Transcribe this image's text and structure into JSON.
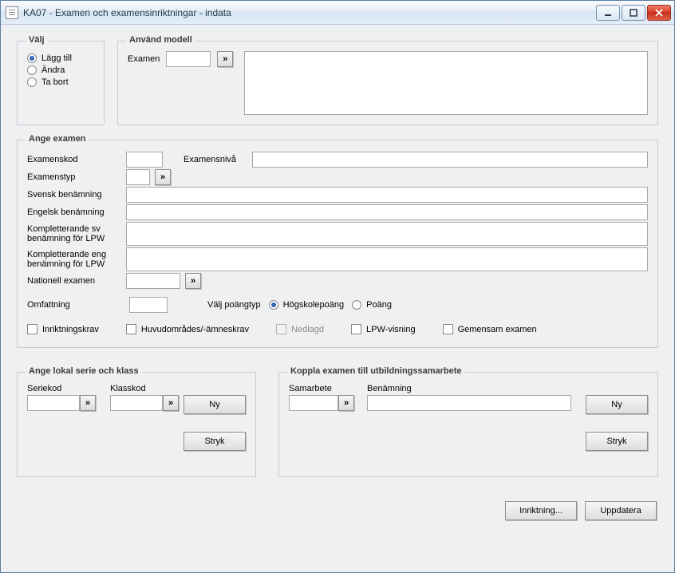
{
  "window": {
    "title": "KA07 - Examen och examensinriktningar - indata"
  },
  "valj": {
    "legend": "Välj",
    "opt_add": "Lägg till",
    "opt_edit": "Ändra",
    "opt_delete": "Ta bort",
    "selected": "add"
  },
  "modell": {
    "legend": "Använd modell",
    "examen_label": "Examen",
    "examen_value": ""
  },
  "ange": {
    "legend": "Ange examen",
    "examenskod_label": "Examenskod",
    "examenskod_value": "",
    "examensniva_label": "Examensnivå",
    "examensniva_value": "",
    "examenstyp_label": "Examenstyp",
    "examenstyp_value": "",
    "svensk_label": "Svensk benämning",
    "svensk_value": "",
    "engelsk_label": "Engelsk benämning",
    "engelsk_value": "",
    "kompl_sv_label_l1": "Kompletterande sv",
    "kompl_sv_label_l2": "benämning för LPW",
    "kompl_sv_value": "",
    "kompl_en_label_l1": "Kompletterande eng",
    "kompl_en_label_l2": "benämning för LPW",
    "kompl_en_value": "",
    "nationell_label": "Nationell examen",
    "nationell_value": "",
    "omfattning_label": "Omfattning",
    "omfattning_value": "",
    "valj_poang_label": "Välj poängtyp",
    "opt_hp": "Högskolepoäng",
    "opt_poang": "Poäng",
    "poang_selected": "hp",
    "chk_inriktningskrav": "Inriktningskrav",
    "chk_huvudomrade": "Huvudområdes/-ämneskrav",
    "chk_nedlagd": "Nedlagd",
    "chk_lpw": "LPW-visning",
    "chk_gemensam": "Gemensam examen"
  },
  "serie": {
    "legend": "Ange lokal serie och klass",
    "seriekod_label": "Seriekod",
    "seriekod_value": "",
    "klasskod_label": "Klasskod",
    "klasskod_value": "",
    "btn_ny": "Ny",
    "btn_stryk": "Stryk"
  },
  "koppla": {
    "legend": "Koppla examen till utbildningssamarbete",
    "samarbete_label": "Samarbete",
    "samarbete_value": "",
    "benamning_label": "Benämning",
    "benamning_value": "",
    "btn_ny": "Ny",
    "btn_stryk": "Stryk"
  },
  "bottom": {
    "btn_inriktning": "Inriktning...",
    "btn_uppdatera": "Uppdatera"
  }
}
